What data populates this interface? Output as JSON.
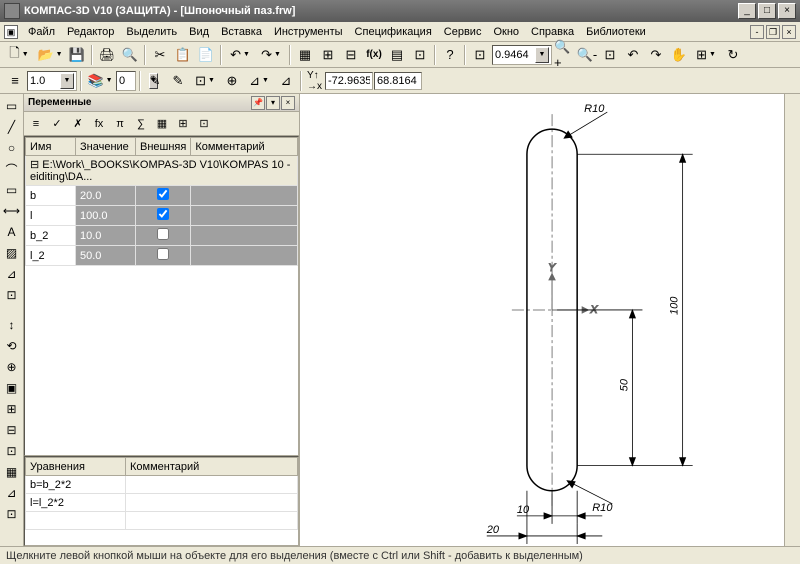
{
  "title": "КОМПАС-3D V10 (ЗАЩИТА) - [Шпоночный паз.frw]",
  "menu": [
    "Файл",
    "Редактор",
    "Выделить",
    "Вид",
    "Вставка",
    "Инструменты",
    "Спецификация",
    "Сервис",
    "Окно",
    "Справка",
    "Библиотеки"
  ],
  "tb2": {
    "style": "1.0",
    "coord_x": "-72.9635",
    "coord_y": "68.8164"
  },
  "tb1": {
    "zoom": "0.9464"
  },
  "panel": {
    "title": "Переменные",
    "cols": [
      "Имя",
      "Значение",
      "Внешняя",
      "Комментарий"
    ],
    "filepath": "E:\\Work\\_BOOKS\\KOMPAS-3D V10\\KOMPAS 10 - eiditing\\DA...",
    "rows": [
      {
        "name": "b",
        "val": "20.0",
        "ext": true
      },
      {
        "name": "l",
        "val": "100.0",
        "ext": true
      },
      {
        "name": "b_2",
        "val": "10.0",
        "ext": false
      },
      {
        "name": "l_2",
        "val": "50.0",
        "ext": false
      }
    ],
    "eqcols": [
      "Уравнения",
      "Комментарий"
    ],
    "eqs": [
      "b=b_2*2",
      "l=l_2*2"
    ]
  },
  "chart_data": {
    "type": "technical_drawing",
    "shape": "obround_slot",
    "dimensions": {
      "width_20": 20,
      "width_10": 10,
      "length_100": 100,
      "length_50": 50,
      "radius_top": "R10",
      "radius_bottom": "R10"
    },
    "axes": [
      "X",
      "Y"
    ]
  },
  "status": "Щелкните левой кнопкой мыши на объекте для его выделения (вместе с Ctrl или Shift - добавить к выделенным)"
}
